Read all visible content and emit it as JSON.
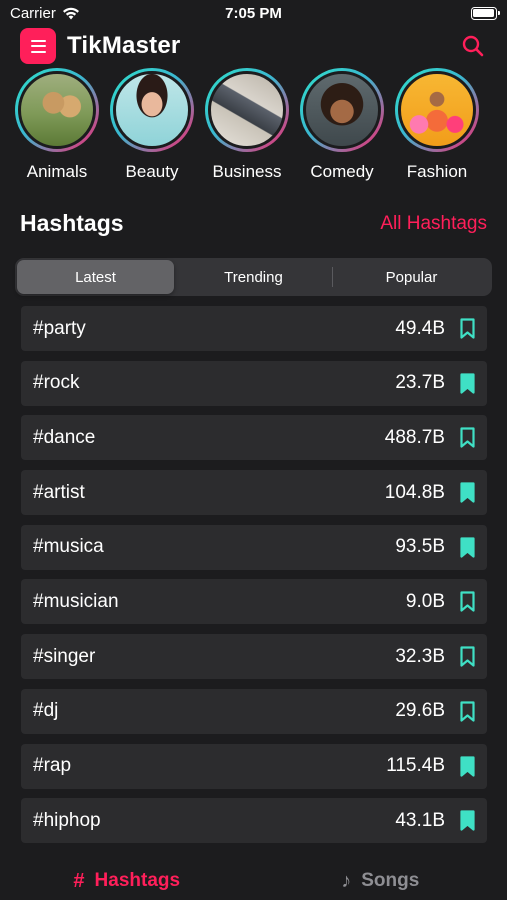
{
  "status_bar": {
    "carrier": "Carrier",
    "time": "7:05 PM"
  },
  "header": {
    "title": "TikMaster"
  },
  "categories": [
    {
      "label": "Animals",
      "image": "animals"
    },
    {
      "label": "Beauty",
      "image": "beauty"
    },
    {
      "label": "Business",
      "image": "business"
    },
    {
      "label": "Comedy",
      "image": "comedy"
    },
    {
      "label": "Fashion",
      "image": "fashion"
    }
  ],
  "hashtags_section": {
    "title": "Hashtags",
    "all_link": "All Hashtags"
  },
  "segments": [
    {
      "label": "Latest",
      "active": true
    },
    {
      "label": "Trending",
      "active": false
    },
    {
      "label": "Popular",
      "active": false
    }
  ],
  "hashtags": [
    {
      "tag": "#party",
      "count": "49.4B",
      "bookmarked": false
    },
    {
      "tag": "#rock",
      "count": "23.7B",
      "bookmarked": true
    },
    {
      "tag": "#dance",
      "count": "488.7B",
      "bookmarked": false
    },
    {
      "tag": "#artist",
      "count": "104.8B",
      "bookmarked": true
    },
    {
      "tag": "#musica",
      "count": "93.5B",
      "bookmarked": true
    },
    {
      "tag": "#musician",
      "count": "9.0B",
      "bookmarked": false
    },
    {
      "tag": "#singer",
      "count": "32.3B",
      "bookmarked": false
    },
    {
      "tag": "#dj",
      "count": "29.6B",
      "bookmarked": false
    },
    {
      "tag": "#rap",
      "count": "115.4B",
      "bookmarked": true
    },
    {
      "tag": "#hiphop",
      "count": "43.1B",
      "bookmarked": true
    }
  ],
  "tabbar": [
    {
      "label": "Hashtags",
      "icon": "hash-icon",
      "active": true
    },
    {
      "label": "Songs",
      "icon": "music-note-icon",
      "active": false
    }
  ],
  "colors": {
    "accent": "#ff1f5a",
    "bookmark": "#3fe0c5",
    "background": "#1c1c1e",
    "row": "#2c2c2e"
  }
}
